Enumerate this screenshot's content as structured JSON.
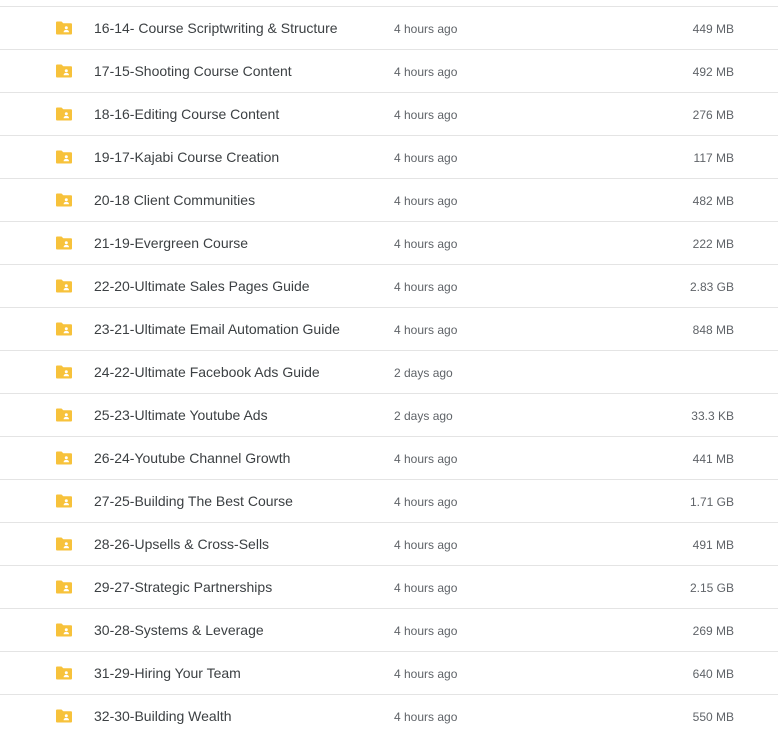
{
  "folder_color": "#f7c23b",
  "folder_icon": "shared-folder-icon",
  "rows": [
    {
      "name": "16-14- Course Scriptwriting & Structure",
      "modified": "4 hours ago",
      "size": "449 MB"
    },
    {
      "name": "17-15-Shooting Course Content",
      "modified": "4 hours ago",
      "size": "492 MB"
    },
    {
      "name": "18-16-Editing Course Content",
      "modified": "4 hours ago",
      "size": "276 MB"
    },
    {
      "name": "19-17-Kajabi Course Creation",
      "modified": "4 hours ago",
      "size": "117 MB"
    },
    {
      "name": "20-18 Client Communities",
      "modified": "4 hours ago",
      "size": "482 MB"
    },
    {
      "name": "21-19-Evergreen Course",
      "modified": "4 hours ago",
      "size": "222 MB"
    },
    {
      "name": "22-20-Ultimate Sales Pages Guide",
      "modified": "4 hours ago",
      "size": "2.83 GB"
    },
    {
      "name": "23-21-Ultimate Email Automation Guide",
      "modified": "4 hours ago",
      "size": "848 MB"
    },
    {
      "name": "24-22-Ultimate Facebook Ads Guide",
      "modified": "2 days ago",
      "size": ""
    },
    {
      "name": "25-23-Ultimate Youtube Ads",
      "modified": "2 days ago",
      "size": "33.3 KB"
    },
    {
      "name": "26-24-Youtube Channel Growth",
      "modified": "4 hours ago",
      "size": "441 MB"
    },
    {
      "name": "27-25-Building The Best Course",
      "modified": "4 hours ago",
      "size": "1.71 GB"
    },
    {
      "name": "28-26-Upsells & Cross-Sells",
      "modified": "4 hours ago",
      "size": "491 MB"
    },
    {
      "name": "29-27-Strategic Partnerships",
      "modified": "4 hours ago",
      "size": "2.15 GB"
    },
    {
      "name": "30-28-Systems & Leverage",
      "modified": "4 hours ago",
      "size": "269 MB"
    },
    {
      "name": "31-29-Hiring Your Team",
      "modified": "4 hours ago",
      "size": "640 MB"
    },
    {
      "name": "32-30-Building Wealth",
      "modified": "4 hours ago",
      "size": "550 MB"
    }
  ]
}
